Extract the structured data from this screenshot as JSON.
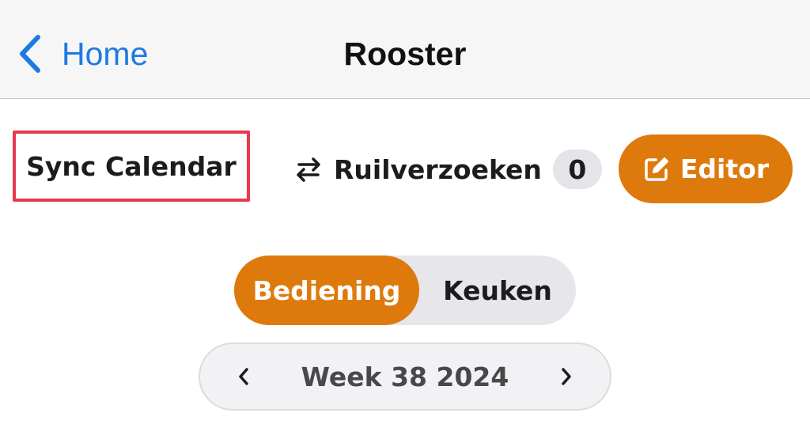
{
  "colors": {
    "accent": "#de7a0c",
    "link": "#1f7ae0",
    "highlight_border": "#e8394f"
  },
  "navbar": {
    "back_label": "Home",
    "back_icon": "chevron-left-icon",
    "title": "Rooster"
  },
  "toolbar": {
    "sync_label": "Sync Calendar",
    "swap_icon": "swap-arrows-icon",
    "swap_label": "Ruilverzoeken",
    "swap_count": "0",
    "editor_icon": "edit-icon",
    "editor_label": "Editor"
  },
  "segments": {
    "items": [
      "Bediening",
      "Keuken"
    ],
    "selected": "Bediening"
  },
  "week_nav": {
    "prev_icon": "chevron-left-icon",
    "label": "Week 38 2024",
    "next_icon": "chevron-right-icon"
  }
}
